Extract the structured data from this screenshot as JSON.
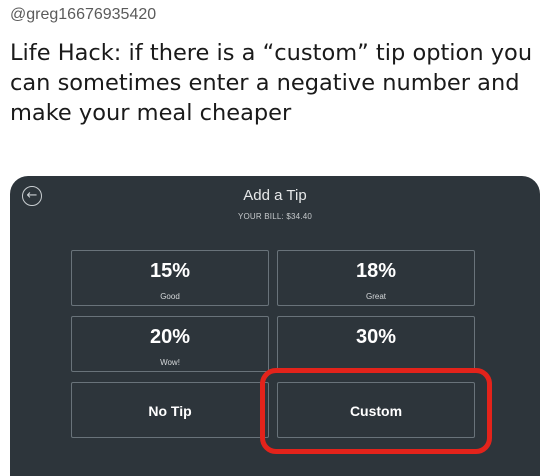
{
  "tweet": {
    "handle": "@greg16676935420",
    "text": "Life Hack: if there is a “custom” tip option you\ncan sometimes enter a negative number and\nmake your meal cheaper"
  },
  "screen": {
    "back_icon": "back-arrow-icon",
    "title": "Add a Tip",
    "bill": "YOUR BILL: $34.40",
    "options": [
      {
        "pct": "15%",
        "label": "Good"
      },
      {
        "pct": "18%",
        "label": "Great"
      },
      {
        "pct": "20%",
        "label": "Wow!"
      },
      {
        "pct": "30%",
        "label": ""
      }
    ],
    "no_tip": "No Tip",
    "custom": "Custom"
  },
  "colors": {
    "background": "#2d353b",
    "highlight": "#e3231b"
  }
}
